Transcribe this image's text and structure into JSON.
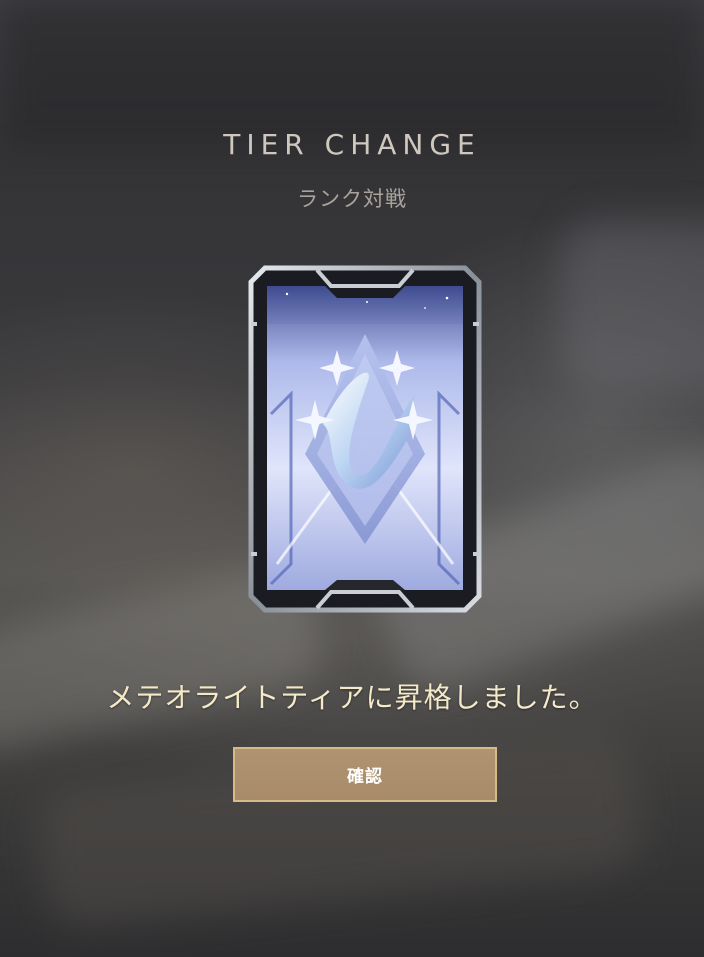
{
  "header": {
    "title": "TIER CHANGE",
    "subtitle": "ランク対戦"
  },
  "card": {
    "emblem": "meteorite-tier-emblem-icon"
  },
  "message": "メテオライトティアに昇格しました。",
  "actions": {
    "confirm_label": "確認"
  },
  "colors": {
    "title": "#cfc8bf",
    "message": "#f4e9c8",
    "button_fill": "#ac8f6d",
    "button_border": "#d8b98a"
  }
}
